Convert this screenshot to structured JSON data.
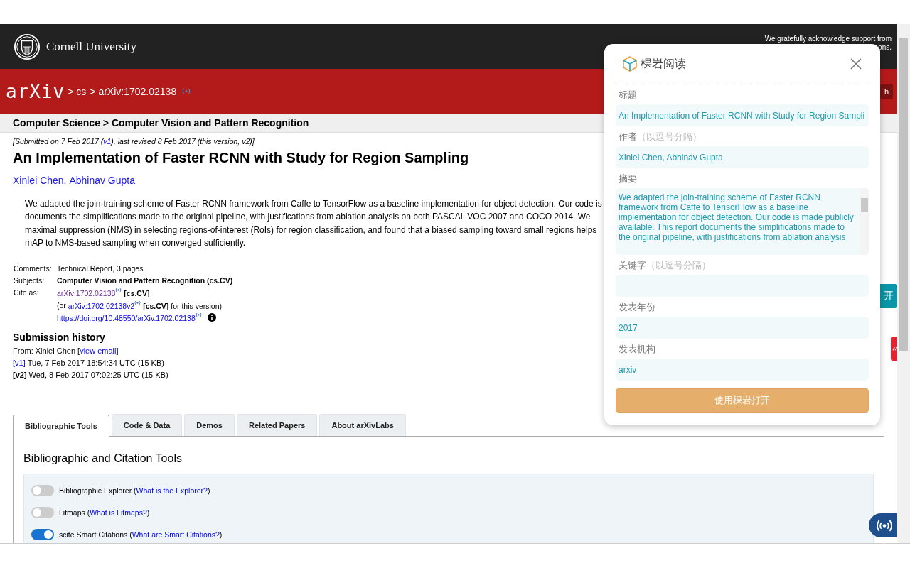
{
  "header": {
    "institution": "Cornell University",
    "support_line_1": "We gratefully acknowledge support from",
    "support_line_2": "ons."
  },
  "nav": {
    "logo_text": "arXiv",
    "breadcrumbs": [
      "> cs",
      "> arXiv:1702.02138"
    ],
    "button_fragment": "h"
  },
  "category": "Computer Science > Computer Vision and Pattern Recognition",
  "paper": {
    "submitted": {
      "before": "[Submitted on 7 Feb 2017 (",
      "link": "v1",
      "after": "), last revised 8 Feb 2017 (this version, v2)]"
    },
    "title": "An Implementation of Faster RCNN with Study for Region Sampling",
    "authors": [
      {
        "name": "Xinlei Chen",
        "after": ","
      },
      {
        "name": "Abhinav Gupta"
      }
    ],
    "abstract_lines": [
      "We adapted the join-training scheme of Faster RCNN framework from Caffe to TensorFlow as a baseline implementation for object detection. Our code is",
      "documents the simplifications made to the original pipeline, with justifications from ablation analysis on both PASCAL VOC 2007 and COCO 2014. We",
      "maximal suppression (NMS) in selecting regions-of-interest (RoIs) for region classification, and found that a biased sampling toward small regions helps",
      "mAP to NMS-based sampling when converged sufficiently."
    ],
    "comments_label": "Comments:",
    "comments": "Technical Report, 3 pages",
    "subjects_label": "Subjects:",
    "subjects": "Computer Vision and Pattern Recognition (cs.CV)",
    "cite_label": "Cite as:",
    "cite_lines": [
      {
        "link": "arXiv:1702.02138",
        "visited": true,
        "suffix": "**[cs.CV]**",
        "info": false
      },
      {
        "prefix": "(or",
        "link": "arXiv:1702.02138v2",
        "visited": false,
        "suffix": "**[cs.CV]** for this version)",
        "info": false
      },
      {
        "link": "https://doi.org/10.48550/arXiv.1702.02138",
        "visited": false,
        "info": true
      }
    ]
  },
  "history": {
    "heading": "Submission history",
    "from_before": "From: Xinlei Chen [",
    "from_link": "view email",
    "from_after": "]",
    "versions": [
      {
        "label": "[v1]",
        "current": false,
        "text": "Tue, 7 Feb 2017 18:54:34 UTC (15 KB)"
      },
      {
        "label": "[v2]",
        "current": true,
        "text": "Wed, 8 Feb 2017 07:02:25 UTC (15 KB)"
      }
    ]
  },
  "tabs": [
    {
      "label": "Bibliographic Tools",
      "selected": true
    },
    {
      "label": "Code & Data",
      "selected": false
    },
    {
      "label": "Demos",
      "selected": false
    },
    {
      "label": "Related Papers",
      "selected": false
    },
    {
      "label": "About arXivLabs",
      "selected": false
    }
  ],
  "tools": {
    "heading": "Bibliographic and Citation Tools",
    "toggles": [
      {
        "label": "Bibliographic Explorer (",
        "link": "What is the Explorer?",
        "after": ")",
        "on": false
      },
      {
        "label": "Litmaps (",
        "link": "What is Litmaps?",
        "after": ")",
        "on": false
      },
      {
        "label": "scite Smart Citations (",
        "link": "What are Smart Citations?",
        "after": ")",
        "on": true
      }
    ]
  },
  "side_fragments": {
    "teal_button": "开",
    "red_tab": "«"
  },
  "popup": {
    "brand": "棵岩阅读",
    "fields": [
      {
        "kind": "line",
        "label": "标题",
        "value": "An Implementation of Faster RCNN with Study for Region Sampli"
      },
      {
        "kind": "line",
        "label": "作者",
        "hint": "（以逗号分隔）",
        "value": "Xinlei Chen, Abhinav Gupta"
      },
      {
        "kind": "area",
        "label": "摘要",
        "value": "We adapted the join-training scheme of Faster RCNN framework from Caffe to TensorFlow as a baseline implementation for object detection. Our code is made publicly available. This report documents the simplifications made to the original pipeline, with justifications from ablation analysis"
      },
      {
        "kind": "line",
        "label": "关键字",
        "hint": "（以逗号分隔）"
      },
      {
        "kind": "line",
        "label": "发表年份",
        "value": "2017"
      },
      {
        "kind": "line",
        "label": "发表机构",
        "value": "arxiv"
      }
    ],
    "button": "使用棵岩打开"
  }
}
